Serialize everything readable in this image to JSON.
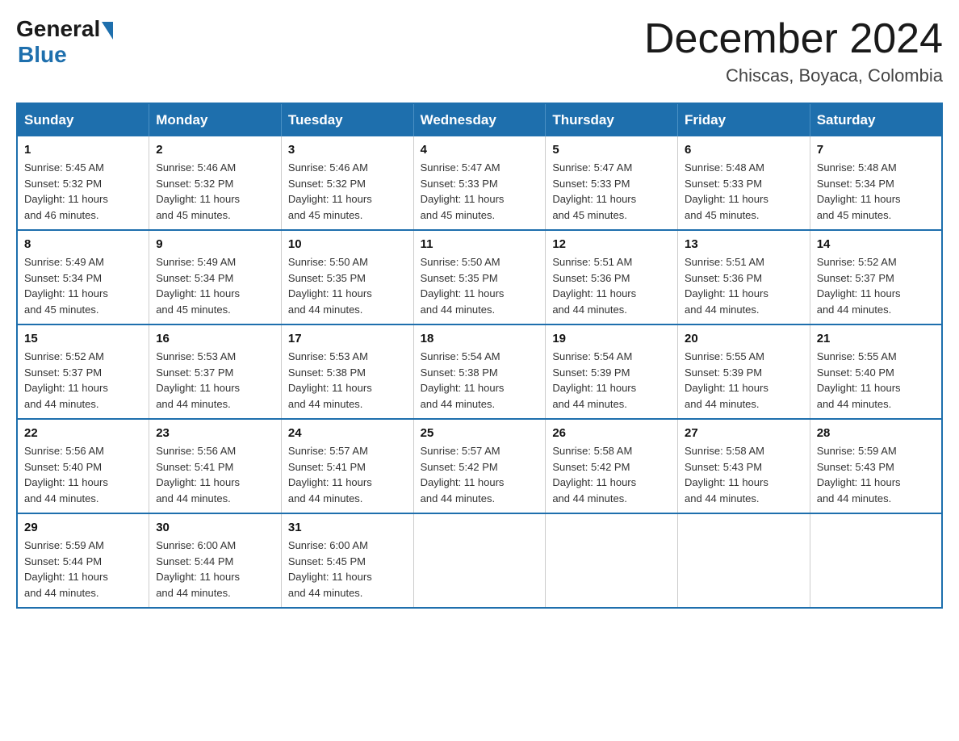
{
  "logo": {
    "general": "General",
    "blue": "Blue"
  },
  "header": {
    "month_year": "December 2024",
    "location": "Chiscas, Boyaca, Colombia"
  },
  "days_of_week": [
    "Sunday",
    "Monday",
    "Tuesday",
    "Wednesday",
    "Thursday",
    "Friday",
    "Saturday"
  ],
  "weeks": [
    [
      {
        "day": "1",
        "sunrise": "5:45 AM",
        "sunset": "5:32 PM",
        "daylight": "11 hours and 46 minutes."
      },
      {
        "day": "2",
        "sunrise": "5:46 AM",
        "sunset": "5:32 PM",
        "daylight": "11 hours and 45 minutes."
      },
      {
        "day": "3",
        "sunrise": "5:46 AM",
        "sunset": "5:32 PM",
        "daylight": "11 hours and 45 minutes."
      },
      {
        "day": "4",
        "sunrise": "5:47 AM",
        "sunset": "5:33 PM",
        "daylight": "11 hours and 45 minutes."
      },
      {
        "day": "5",
        "sunrise": "5:47 AM",
        "sunset": "5:33 PM",
        "daylight": "11 hours and 45 minutes."
      },
      {
        "day": "6",
        "sunrise": "5:48 AM",
        "sunset": "5:33 PM",
        "daylight": "11 hours and 45 minutes."
      },
      {
        "day": "7",
        "sunrise": "5:48 AM",
        "sunset": "5:34 PM",
        "daylight": "11 hours and 45 minutes."
      }
    ],
    [
      {
        "day": "8",
        "sunrise": "5:49 AM",
        "sunset": "5:34 PM",
        "daylight": "11 hours and 45 minutes."
      },
      {
        "day": "9",
        "sunrise": "5:49 AM",
        "sunset": "5:34 PM",
        "daylight": "11 hours and 45 minutes."
      },
      {
        "day": "10",
        "sunrise": "5:50 AM",
        "sunset": "5:35 PM",
        "daylight": "11 hours and 44 minutes."
      },
      {
        "day": "11",
        "sunrise": "5:50 AM",
        "sunset": "5:35 PM",
        "daylight": "11 hours and 44 minutes."
      },
      {
        "day": "12",
        "sunrise": "5:51 AM",
        "sunset": "5:36 PM",
        "daylight": "11 hours and 44 minutes."
      },
      {
        "day": "13",
        "sunrise": "5:51 AM",
        "sunset": "5:36 PM",
        "daylight": "11 hours and 44 minutes."
      },
      {
        "day": "14",
        "sunrise": "5:52 AM",
        "sunset": "5:37 PM",
        "daylight": "11 hours and 44 minutes."
      }
    ],
    [
      {
        "day": "15",
        "sunrise": "5:52 AM",
        "sunset": "5:37 PM",
        "daylight": "11 hours and 44 minutes."
      },
      {
        "day": "16",
        "sunrise": "5:53 AM",
        "sunset": "5:37 PM",
        "daylight": "11 hours and 44 minutes."
      },
      {
        "day": "17",
        "sunrise": "5:53 AM",
        "sunset": "5:38 PM",
        "daylight": "11 hours and 44 minutes."
      },
      {
        "day": "18",
        "sunrise": "5:54 AM",
        "sunset": "5:38 PM",
        "daylight": "11 hours and 44 minutes."
      },
      {
        "day": "19",
        "sunrise": "5:54 AM",
        "sunset": "5:39 PM",
        "daylight": "11 hours and 44 minutes."
      },
      {
        "day": "20",
        "sunrise": "5:55 AM",
        "sunset": "5:39 PM",
        "daylight": "11 hours and 44 minutes."
      },
      {
        "day": "21",
        "sunrise": "5:55 AM",
        "sunset": "5:40 PM",
        "daylight": "11 hours and 44 minutes."
      }
    ],
    [
      {
        "day": "22",
        "sunrise": "5:56 AM",
        "sunset": "5:40 PM",
        "daylight": "11 hours and 44 minutes."
      },
      {
        "day": "23",
        "sunrise": "5:56 AM",
        "sunset": "5:41 PM",
        "daylight": "11 hours and 44 minutes."
      },
      {
        "day": "24",
        "sunrise": "5:57 AM",
        "sunset": "5:41 PM",
        "daylight": "11 hours and 44 minutes."
      },
      {
        "day": "25",
        "sunrise": "5:57 AM",
        "sunset": "5:42 PM",
        "daylight": "11 hours and 44 minutes."
      },
      {
        "day": "26",
        "sunrise": "5:58 AM",
        "sunset": "5:42 PM",
        "daylight": "11 hours and 44 minutes."
      },
      {
        "day": "27",
        "sunrise": "5:58 AM",
        "sunset": "5:43 PM",
        "daylight": "11 hours and 44 minutes."
      },
      {
        "day": "28",
        "sunrise": "5:59 AM",
        "sunset": "5:43 PM",
        "daylight": "11 hours and 44 minutes."
      }
    ],
    [
      {
        "day": "29",
        "sunrise": "5:59 AM",
        "sunset": "5:44 PM",
        "daylight": "11 hours and 44 minutes."
      },
      {
        "day": "30",
        "sunrise": "6:00 AM",
        "sunset": "5:44 PM",
        "daylight": "11 hours and 44 minutes."
      },
      {
        "day": "31",
        "sunrise": "6:00 AM",
        "sunset": "5:45 PM",
        "daylight": "11 hours and 44 minutes."
      },
      null,
      null,
      null,
      null
    ]
  ],
  "labels": {
    "sunrise": "Sunrise:",
    "sunset": "Sunset:",
    "daylight": "Daylight:"
  }
}
